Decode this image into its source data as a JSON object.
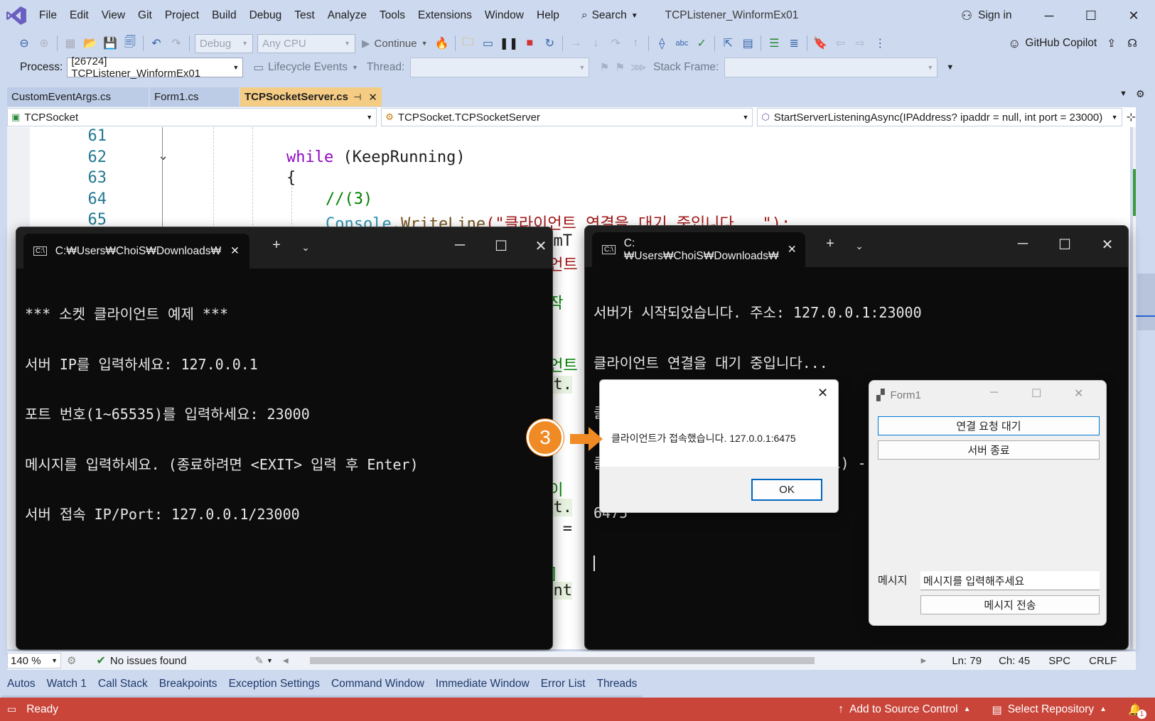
{
  "menu": {
    "items": [
      "File",
      "Edit",
      "View",
      "Git",
      "Project",
      "Build",
      "Debug",
      "Test",
      "Analyze",
      "Tools",
      "Extensions",
      "Window",
      "Help"
    ],
    "search_label": "Search",
    "solution_title": "TCPListener_WinformEx01",
    "sign_in": "Sign in"
  },
  "toolbar": {
    "config": "Debug",
    "platform": "Any CPU",
    "continue_label": "Continue",
    "copilot_label": "GitHub Copilot"
  },
  "processbar": {
    "process_label": "Process:",
    "process_value": "[26724] TCPListener_WinformEx01",
    "lifecycle_label": "Lifecycle Events",
    "thread_label": "Thread:",
    "stackframe_label": "Stack Frame:"
  },
  "tabs": [
    {
      "label": "CustomEventArgs.cs"
    },
    {
      "label": "Form1.cs"
    },
    {
      "label": "TCPSocketServer.cs"
    }
  ],
  "navbar": {
    "project": "TCPSocket",
    "class": "TCPSocket.TCPSocketServer",
    "member": "StartServerListeningAsync(IPAddress? ipaddr = null, int port = 23000)"
  },
  "editor": {
    "line_numbers": [
      "61",
      "62",
      "63",
      "64",
      "65"
    ],
    "code": {
      "kw_while": "while",
      "while_cond": " (KeepRunning)",
      "brace": "{",
      "comment": "//(3)",
      "console": "Console",
      "dot": ".",
      "writeline": "WriteLine",
      "str": "(\"클라이언트 연결을 대기 중입니다...\");",
      "frag_mt": "t mT",
      "frag_client": "이언트",
      "frag_action": "동작",
      "frag_client2": "이언트",
      "frag_ent": "ent.",
      "frag_data": "데이",
      "frag_ent2": "ent.",
      "frag_gs": "gs =",
      "frag_call": "출]",
      "frag_event": "vent"
    }
  },
  "client_console": {
    "title": "C:₩Users₩ChoiS₩Downloads₩",
    "lines": [
      "*** 소켓 클라이언트 예제 ***",
      "서버 IP를 입력하세요: 127.0.0.1",
      "포트 번호(1~65535)를 입력하세요: 23000",
      "메시지를 입력하세요. (종료하려면 <EXIT> 입력 후 Enter)",
      "서버 접속 IP/Port: 127.0.0.1/23000"
    ]
  },
  "server_console": {
    "title": "C:₩Users₩ChoiS₩Downloads₩",
    "lines": [
      "서버가 시작되었습니다. 주소: 127.0.0.1:23000",
      "클라이언트 연결을 대기 중입니다...",
      "클라이언트가 연결되었습니다.",
      "클라이언트 연결 완료 (총 연결 수: 1) - 원격 주소: 127.0.0.1:",
      "6475"
    ]
  },
  "msgbox": {
    "message": "클라이언트가 접속했습니다. 127.0.0.1:6475",
    "ok_label": "OK",
    "callout_number": "3"
  },
  "form1": {
    "title": "Form1",
    "listen_button": "연결 요청 대기",
    "stop_button": "서버 종료",
    "message_label": "메시지",
    "message_input": "메시지를 입력해주세요",
    "send_button": "메시지 전송"
  },
  "editor_status": {
    "zoom": "140 %",
    "issues": "No issues found",
    "ln": "Ln: 79",
    "ch": "Ch: 45",
    "spc": "SPC",
    "crlf": "CRLF"
  },
  "tool_tabs": [
    "Autos",
    "Watch 1",
    "Call Stack",
    "Breakpoints",
    "Exception Settings",
    "Command Window",
    "Immediate Window",
    "Error List",
    "Threads"
  ],
  "statusbar": {
    "ready": "Ready",
    "add_source_control": "Add to Source Control",
    "select_repo": "Select Repository",
    "notif_count": "1"
  },
  "colors": {
    "accent_orange": "#f08a24",
    "status_bar": "#c9453a",
    "active_tab": "#f5cc84"
  }
}
